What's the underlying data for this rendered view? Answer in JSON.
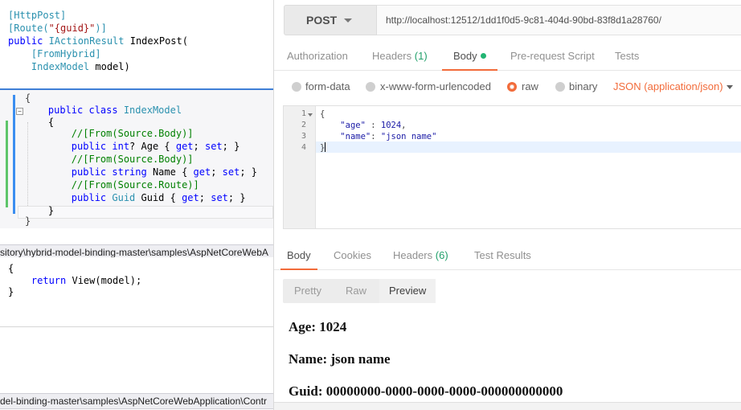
{
  "vs": {
    "attr_code": [
      [
        {
          "c": "ty",
          "t": "[HttpPost]"
        }
      ],
      [
        {
          "c": "ty",
          "t": "[Route("
        },
        {
          "c": "st",
          "t": "\"{guid}\""
        },
        {
          "c": "ty",
          "t": ")]"
        }
      ],
      [
        {
          "c": "kw",
          "t": "public "
        },
        {
          "c": "ty",
          "t": "IActionResult "
        },
        {
          "c": "pl",
          "t": "IndexPost("
        }
      ],
      [
        {
          "c": "pl",
          "t": "    "
        },
        {
          "c": "ty",
          "t": "[FromHybrid]"
        }
      ],
      [
        {
          "c": "pl",
          "t": "    "
        },
        {
          "c": "ty",
          "t": "IndexModel "
        },
        {
          "c": "pl",
          "t": "model)"
        }
      ]
    ],
    "class_code": [
      [
        {
          "c": "br",
          "t": "{"
        }
      ],
      [
        {
          "c": "pl",
          "t": "    "
        },
        {
          "c": "kw",
          "t": "public class "
        },
        {
          "c": "ty",
          "t": "IndexModel"
        }
      ],
      [
        {
          "c": "pl",
          "t": "    {"
        }
      ],
      [
        {
          "c": "cm",
          "t": "        //[From(Source.Body)]"
        }
      ],
      [
        {
          "c": "pl",
          "t": "        "
        },
        {
          "c": "kw",
          "t": "public int"
        },
        {
          "c": "pl",
          "t": "? Age { "
        },
        {
          "c": "kw",
          "t": "get"
        },
        {
          "c": "pl",
          "t": "; "
        },
        {
          "c": "kw",
          "t": "set"
        },
        {
          "c": "pl",
          "t": "; }"
        }
      ],
      [
        {
          "c": "cm",
          "t": "        //[From(Source.Body)]"
        }
      ],
      [
        {
          "c": "pl",
          "t": "        "
        },
        {
          "c": "kw",
          "t": "public string "
        },
        {
          "c": "pl",
          "t": "Name { "
        },
        {
          "c": "kw",
          "t": "get"
        },
        {
          "c": "pl",
          "t": "; "
        },
        {
          "c": "kw",
          "t": "set"
        },
        {
          "c": "pl",
          "t": "; }"
        }
      ],
      [
        {
          "c": "cm",
          "t": "        //[From(Source.Route)]"
        }
      ],
      [
        {
          "c": "pl",
          "t": "        "
        },
        {
          "c": "kw",
          "t": "public "
        },
        {
          "c": "ty",
          "t": "Guid "
        },
        {
          "c": "pl",
          "t": "Guid { "
        },
        {
          "c": "kw",
          "t": "get"
        },
        {
          "c": "pl",
          "t": "; "
        },
        {
          "c": "kw",
          "t": "set"
        },
        {
          "c": "pl",
          "t": "; }"
        }
      ],
      [
        {
          "c": "pl",
          "t": "    }"
        }
      ],
      [
        {
          "c": "br",
          "t": "}"
        }
      ]
    ],
    "path1": "sitory\\hybrid-model-binding-master\\samples\\AspNetCoreWebA",
    "method_code": [
      [
        {
          "c": "pl",
          "t": "{"
        }
      ],
      [
        {
          "c": "pl",
          "t": "    "
        },
        {
          "c": "kw",
          "t": "return "
        },
        {
          "c": "pl",
          "t": "View(model);"
        }
      ],
      [
        {
          "c": "pl",
          "t": "}"
        }
      ]
    ],
    "path2": "del-binding-master\\samples\\AspNetCoreWebApplication\\Contr"
  },
  "postman": {
    "method": "POST",
    "url": "http://localhost:12512/1dd1f0d5-9c81-404d-90bd-83f8d1a28760/",
    "request_tabs": {
      "authorization": "Authorization",
      "headers": "Headers",
      "headers_count": "(1)",
      "body": "Body",
      "prerequest": "Pre-request Script",
      "tests": "Tests"
    },
    "body_options": {
      "form_data": "form-data",
      "urlencoded": "x-www-form-urlencoded",
      "raw": "raw",
      "binary": "binary",
      "content_type": "JSON (application/json)"
    },
    "editor": {
      "line_numbers": [
        "1",
        "2",
        "3",
        "4"
      ],
      "open_brace": "{",
      "age_key": "\"age\"",
      "age_sep": " : ",
      "age_value": "1024",
      "age_comma": ",",
      "name_key": "\"name\"",
      "name_sep": ": ",
      "name_value": "\"json name\"",
      "close_brace": "}"
    },
    "response_tabs": {
      "body": "Body",
      "cookies": "Cookies",
      "headers": "Headers",
      "headers_count": "(6)",
      "test_results": "Test Results"
    },
    "view_modes": {
      "pretty": "Pretty",
      "raw": "Raw",
      "preview": "Preview"
    },
    "preview": {
      "age": "Age: 1024",
      "name": "Name: json name",
      "guid": "Guid: 00000000-0000-0000-0000-000000000000"
    }
  },
  "colors": {
    "accent": "#f26b3a",
    "count_green": "#22a06b",
    "vs_blue": "#3b8ef0",
    "vs_green": "#5ec56a"
  }
}
